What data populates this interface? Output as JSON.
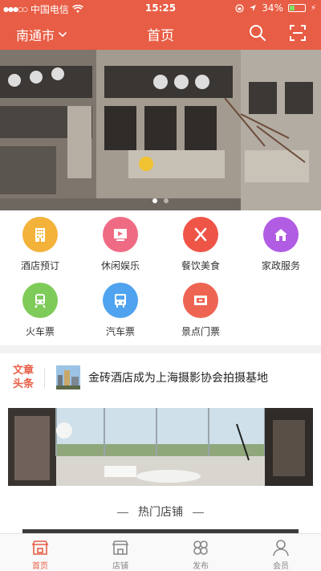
{
  "status_bar": {
    "carrier": "中国电信",
    "time": "15:25",
    "battery": "34%",
    "battery_level": 0.34
  },
  "header": {
    "city": "南通市",
    "title": "首页",
    "search_icon": "search-icon",
    "scan_icon": "scan-icon"
  },
  "banner": {
    "slide_count": 2,
    "active_slide": 1
  },
  "categories": [
    {
      "label": "酒店预订",
      "icon": "hotel-icon",
      "color": "#f3b23a"
    },
    {
      "label": "休闲娱乐",
      "icon": "entertainment-icon",
      "color": "#ef6b84"
    },
    {
      "label": "餐饮美食",
      "icon": "fork-knife-icon",
      "color": "#ee5547"
    },
    {
      "label": "家政服务",
      "icon": "house-icon",
      "color": "#b05ce3"
    },
    {
      "label": "火车票",
      "icon": "train-icon",
      "color": "#7fcb5a"
    },
    {
      "label": "汽车票",
      "icon": "bus-icon",
      "color": "#4fa3ef"
    },
    {
      "label": "景点门票",
      "icon": "ticket-icon",
      "color": "#ee6452"
    }
  ],
  "headline": {
    "tag": "文章头条",
    "text": "金砖酒店成为上海摄影协会拍摄基地"
  },
  "hot_shops": {
    "title": "热门店铺"
  },
  "tabs": [
    {
      "label": "首页",
      "icon": "home-shop-icon",
      "active": true
    },
    {
      "label": "店铺",
      "icon": "store-icon",
      "active": false
    },
    {
      "label": "发布",
      "icon": "grid-petals-icon",
      "active": false
    },
    {
      "label": "会员",
      "icon": "user-icon",
      "active": false
    }
  ],
  "colors": {
    "brand": "#e85d45",
    "tab_inactive": "#888888"
  }
}
